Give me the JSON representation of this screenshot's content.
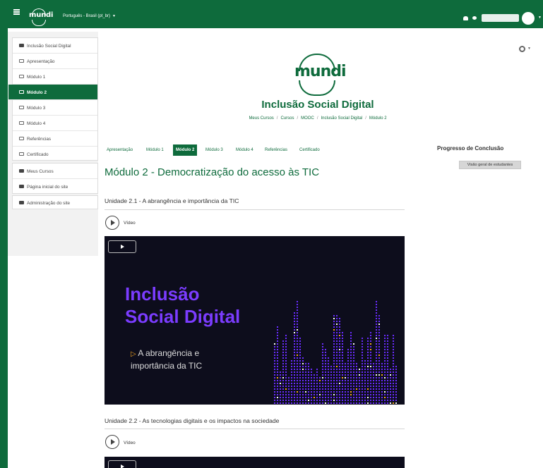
{
  "navbar": {
    "logo_text": "mundi",
    "language": "Português - Brasil (pt_br)",
    "icons": [
      "menu-icon",
      "bell-icon",
      "chat-icon",
      "user-avatar",
      "caret-down-icon"
    ],
    "brand_color": "#0e6b3c"
  },
  "sidebar": {
    "items": [
      {
        "label": "Inclusão Social Digital",
        "icon": "graduation-cap-icon"
      },
      {
        "label": "Apresentação",
        "icon": "folder-icon"
      },
      {
        "label": "Módulo 1",
        "icon": "folder-icon"
      },
      {
        "label": "Módulo 2",
        "icon": "folder-icon",
        "active": true
      },
      {
        "label": "Módulo 3",
        "icon": "folder-icon"
      },
      {
        "label": "Módulo 4",
        "icon": "folder-icon"
      },
      {
        "label": "Referências",
        "icon": "folder-icon"
      },
      {
        "label": "Certificado",
        "icon": "folder-icon"
      },
      {
        "label": "Meus Cursos",
        "icon": "dashboard-icon"
      },
      {
        "label": "Página inicial do site",
        "icon": "home-icon"
      },
      {
        "label": "Administração do site",
        "icon": "wrench-icon"
      }
    ]
  },
  "header": {
    "logo_text": "mundi",
    "course_title": "Inclusão Social Digital",
    "breadcrumb": [
      "Meus Cursos",
      "Cursos",
      "MOOC",
      "Inclusão Social Digital",
      "Módulo 2"
    ]
  },
  "tabs": [
    "Apresentação",
    "Módulo 1",
    "Módulo 2",
    "Módulo 3",
    "Módulo 4",
    "Referências",
    "Certificado"
  ],
  "active_tab": "Módulo 2",
  "main": {
    "module_title": "Módulo 2 - Democratização do acesso às TIC",
    "units": [
      {
        "title": "Unidade 2.1 - A abrangência e importância da TIC",
        "resource_label": "Vídeo",
        "video_title_line1": "Inclusão",
        "video_title_line2": "Social Digital",
        "video_sub_line1": "A abrangência e",
        "video_sub_line2": "importância da TIC"
      },
      {
        "title": "Unidade 2.2 - As tecnologias digitais e os impactos na sociedade",
        "resource_label": "Vídeo"
      }
    ]
  },
  "right": {
    "progress_heading": "Progresso de Conclusão",
    "overview_button": "Visão geral de estudantes"
  }
}
